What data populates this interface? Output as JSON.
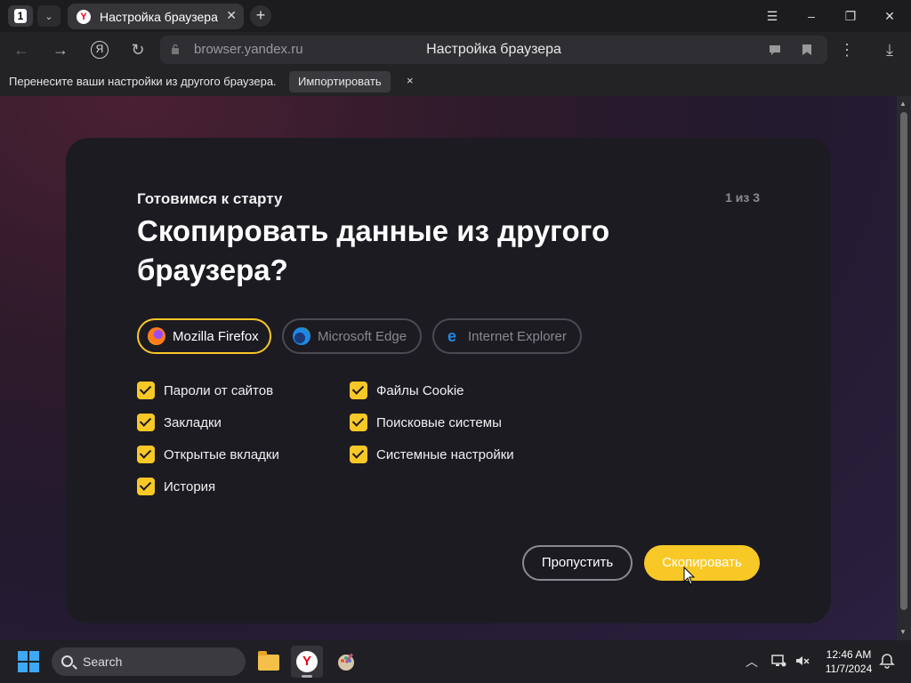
{
  "tabbar": {
    "tab_count": "1",
    "tab_title": "Настройка браузера",
    "new_tab": "+"
  },
  "window_controls": {
    "menu": "☰",
    "minimize": "–",
    "restore": "❐",
    "close": "✕"
  },
  "navbar": {
    "url": "browser.yandex.ru",
    "page_title": "Настройка браузера",
    "yandex_button": "Я"
  },
  "infobar": {
    "text": "Перенесите ваши настройки из другого браузера.",
    "import_label": "Импортировать",
    "close": "×"
  },
  "card": {
    "subtitle": "Готовимся к старту",
    "step": "1 из 3",
    "heading": "Скопировать данные из другого браузера?",
    "browsers": [
      {
        "label": "Mozilla Firefox",
        "icon": "firefox-icon",
        "selected": true
      },
      {
        "label": "Microsoft Edge",
        "icon": "edge-icon",
        "selected": false
      },
      {
        "label": "Internet Explorer",
        "icon": "internet-explorer-icon",
        "selected": false
      }
    ],
    "options": [
      {
        "label": "Пароли от сайтов",
        "checked": true
      },
      {
        "label": "Закладки",
        "checked": true
      },
      {
        "label": "Открытые вкладки",
        "checked": true
      },
      {
        "label": "История",
        "checked": true
      },
      {
        "label": "Файлы Cookie",
        "checked": true
      },
      {
        "label": "Поисковые системы",
        "checked": true
      },
      {
        "label": "Системные настройки",
        "checked": true
      }
    ],
    "skip_label": "Пропустить",
    "copy_label": "Скопировать"
  },
  "taskbar": {
    "search_label": "Search",
    "time": "12:46 AM",
    "date": "11/7/2024"
  },
  "colors": {
    "accent": "#f8c826",
    "card_bg": "#1c1b22"
  }
}
